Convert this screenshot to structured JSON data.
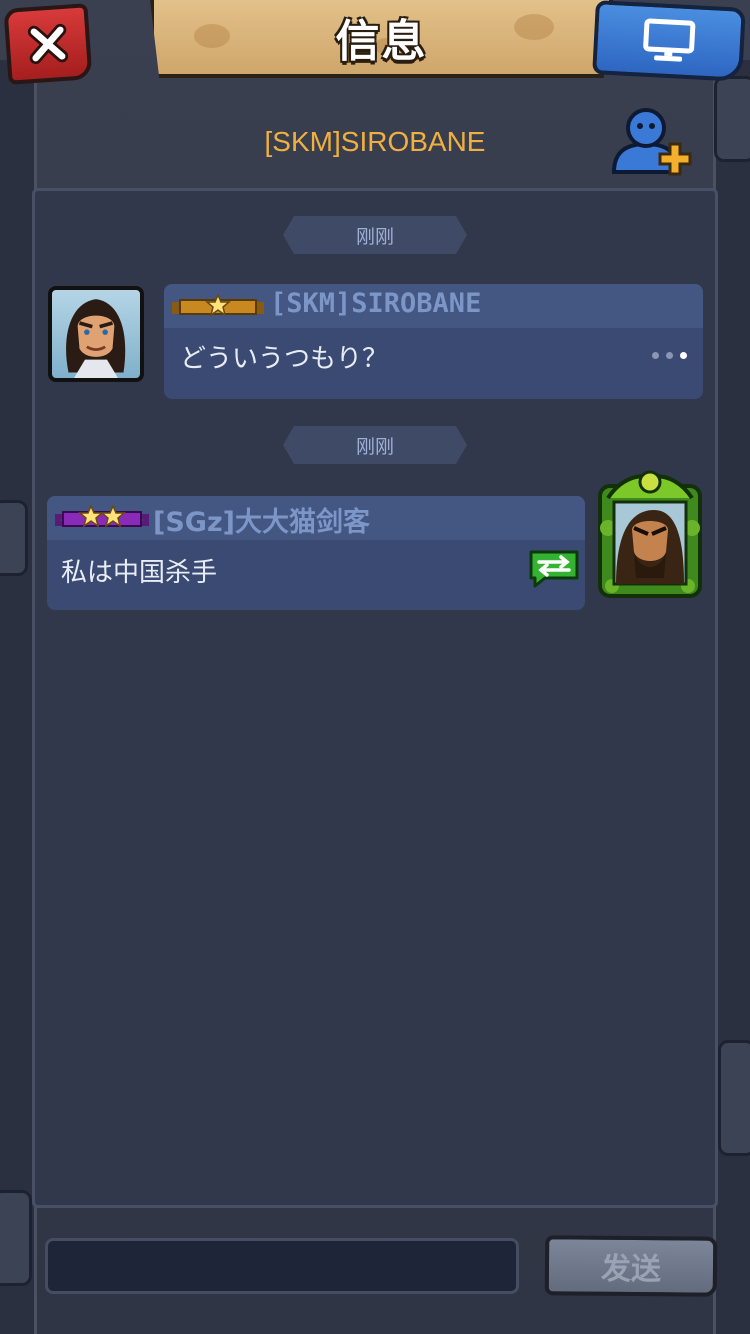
{
  "header": {
    "title": "信息",
    "close_icon": "close-x-icon",
    "screen_icon": "monitor-icon",
    "conversation_name": "[SKM]SIROBANE",
    "add_friend_icon": "add-friend-icon"
  },
  "colors": {
    "accent_orange": "#f0b040",
    "close_red": "#c02a2a",
    "screen_blue": "#3a7ad6",
    "bubble_bg": "#3b4a72",
    "name_blue": "#7c96c8",
    "translate_green": "#34b232"
  },
  "messages": [
    {
      "time": "刚刚",
      "sender": "[SKM]SIROBANE",
      "rank_stars": 1,
      "rank_color": "gold",
      "text": "どういうつもり？",
      "side": "left",
      "avatar_icon": "hero-avatar-icon",
      "status_icon": "more-dots-icon"
    },
    {
      "time": "刚刚",
      "sender": "[SGz]大大猫剑客",
      "rank_stars": 2,
      "rank_color": "purple",
      "text": "私は中国杀手",
      "side": "right",
      "avatar_icon": "warrior-avatar-icon",
      "status_icon": "translate-icon"
    }
  ],
  "input": {
    "value": "",
    "placeholder": ""
  },
  "send_button": {
    "label": "发送"
  }
}
